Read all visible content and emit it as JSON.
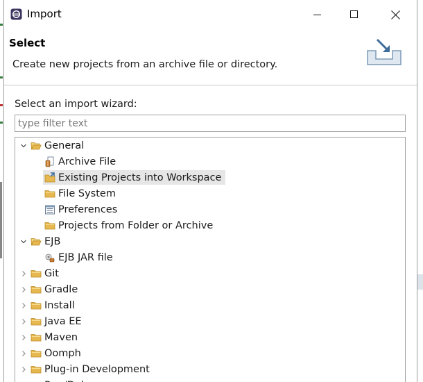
{
  "window": {
    "title": "Import"
  },
  "banner": {
    "title": "Select",
    "description": "Create new projects from an archive file or directory."
  },
  "wizard": {
    "label": "Select an import wizard:",
    "filter_placeholder": "type filter text",
    "filter_value": ""
  },
  "tree": {
    "items": [
      {
        "label": "General",
        "level": 0,
        "expanded": true,
        "icon": "folder-open-icon"
      },
      {
        "label": "Archive File",
        "level": 1,
        "icon": "archive-file-icon"
      },
      {
        "label": "Existing Projects into Workspace",
        "level": 1,
        "icon": "existing-projects-icon",
        "selected": true
      },
      {
        "label": "File System",
        "level": 1,
        "icon": "folder-icon"
      },
      {
        "label": "Preferences",
        "level": 1,
        "icon": "preferences-icon"
      },
      {
        "label": "Projects from Folder or Archive",
        "level": 1,
        "icon": "folder-icon"
      },
      {
        "label": "EJB",
        "level": 0,
        "expanded": true,
        "icon": "folder-open-icon"
      },
      {
        "label": "EJB JAR file",
        "level": 1,
        "icon": "ejb-jar-icon"
      },
      {
        "label": "Git",
        "level": 0,
        "expanded": false,
        "icon": "folder-icon"
      },
      {
        "label": "Gradle",
        "level": 0,
        "expanded": false,
        "icon": "folder-icon"
      },
      {
        "label": "Install",
        "level": 0,
        "expanded": false,
        "icon": "folder-icon"
      },
      {
        "label": "Java EE",
        "level": 0,
        "expanded": false,
        "icon": "folder-icon"
      },
      {
        "label": "Maven",
        "level": 0,
        "expanded": false,
        "icon": "folder-icon"
      },
      {
        "label": "Oomph",
        "level": 0,
        "expanded": false,
        "icon": "folder-icon"
      },
      {
        "label": "Plug-in Development",
        "level": 0,
        "expanded": false,
        "icon": "folder-icon"
      },
      {
        "label": "Run/Debug",
        "level": 0,
        "expanded": false,
        "icon": "folder-icon"
      }
    ]
  },
  "colors": {
    "selection": "#e6e6e6",
    "folder": "#e8b850",
    "border": "#a0a0a0"
  }
}
